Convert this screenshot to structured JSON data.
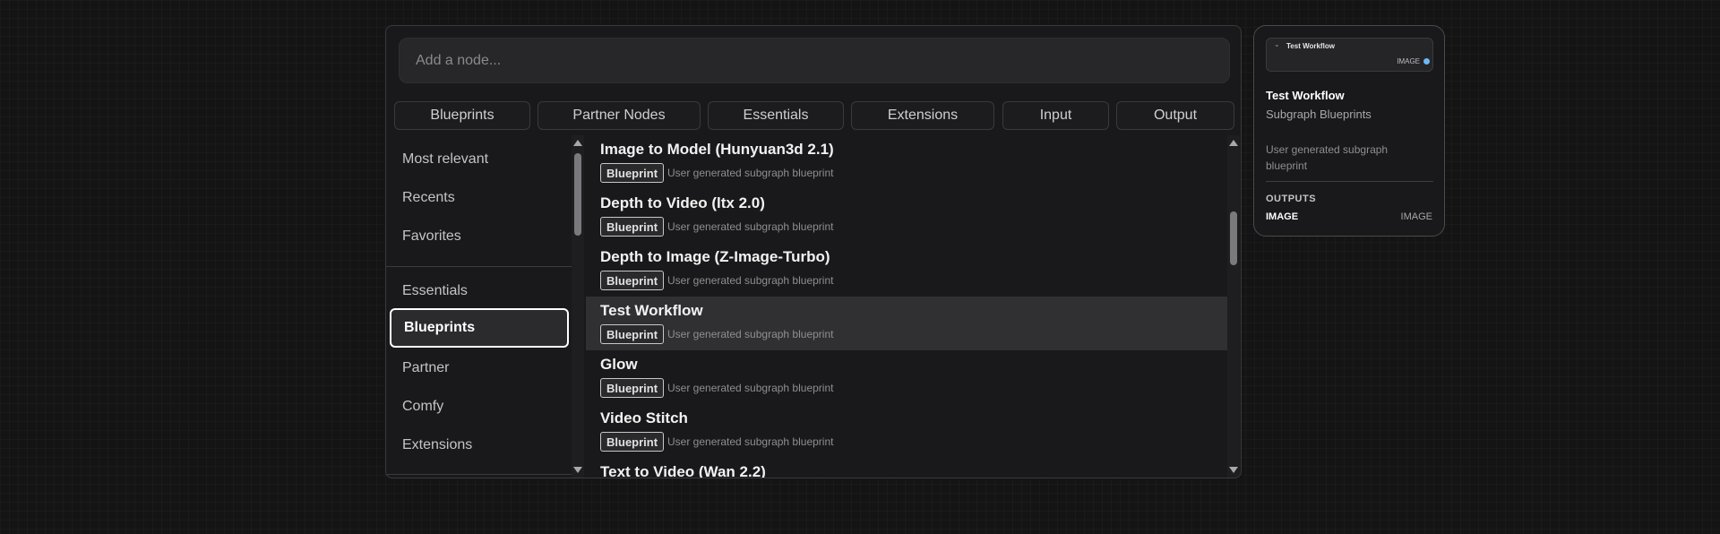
{
  "search": {
    "placeholder": "Add a node..."
  },
  "filters": [
    {
      "label": "Blueprints"
    },
    {
      "label": "Partner Nodes"
    },
    {
      "label": "Essentials"
    },
    {
      "label": "Extensions"
    },
    {
      "label": "Input"
    },
    {
      "label": "Output"
    }
  ],
  "sidebar": {
    "items": [
      {
        "label": "Most relevant"
      },
      {
        "label": "Recents"
      },
      {
        "label": "Favorites"
      },
      {
        "label": "Essentials"
      },
      {
        "label": "Blueprints"
      },
      {
        "label": "Partner"
      },
      {
        "label": "Comfy"
      },
      {
        "label": "Extensions"
      }
    ],
    "active": "Blueprints"
  },
  "results": [
    {
      "title": "Image to Model (Hunyuan3d 2.1)",
      "badge": "Blueprint",
      "desc": "User generated subgraph blueprint"
    },
    {
      "title": "Depth to Video (ltx 2.0)",
      "badge": "Blueprint",
      "desc": "User generated subgraph blueprint"
    },
    {
      "title": "Depth to Image (Z-Image-Turbo)",
      "badge": "Blueprint",
      "desc": "User generated subgraph blueprint"
    },
    {
      "title": "Test Workflow",
      "badge": "Blueprint",
      "desc": "User generated subgraph blueprint"
    },
    {
      "title": "Glow",
      "badge": "Blueprint",
      "desc": "User generated subgraph blueprint"
    },
    {
      "title": "Video Stitch",
      "badge": "Blueprint",
      "desc": "User generated subgraph blueprint"
    },
    {
      "title": "Text to Video (Wan 2.2)",
      "badge": "",
      "desc": ""
    }
  ],
  "selected_result": "Test Workflow",
  "preview": {
    "node_title": "Test Workflow",
    "node_output": "IMAGE",
    "title": "Test Workflow",
    "category": "Subgraph Blueprints",
    "description": "User generated subgraph blueprint",
    "outputs_heading": "OUTPUTS",
    "outputs": [
      {
        "name": "IMAGE",
        "type": "IMAGE"
      }
    ]
  },
  "colors": {
    "port": "#6cb8f5",
    "selected_row": "#303033"
  }
}
